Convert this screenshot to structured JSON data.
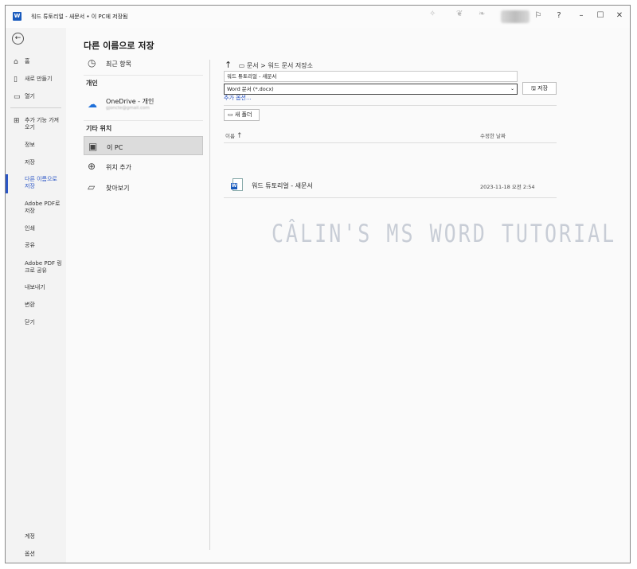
{
  "titlebar": {
    "title": "워드 튜토리얼 - 새문서 • 이 PC에 저장됨",
    "app_icon": "word-logo",
    "buttons": [
      "feedback-icon",
      "help-icon",
      "minimize-icon",
      "maximize-icon",
      "close-icon"
    ]
  },
  "sidebar": {
    "items": [
      {
        "label": "홈",
        "icon": "home-icon"
      },
      {
        "label": "새로 만들기",
        "icon": "new-doc-icon"
      },
      {
        "label": "열기",
        "icon": "folder-open-icon"
      },
      {
        "label": "추가 기능 가져오기",
        "icon": "addin-grid-icon"
      },
      {
        "label": "정보"
      },
      {
        "label": "저장"
      },
      {
        "label": "다른 이름으로 저장"
      },
      {
        "label": "Adobe PDF로 저장"
      },
      {
        "label": "인쇄"
      },
      {
        "label": "공유"
      },
      {
        "label": "Adobe PDF 링크로 공유"
      },
      {
        "label": "내보내기"
      },
      {
        "label": "변환"
      },
      {
        "label": "닫기"
      }
    ],
    "bottom": [
      {
        "label": "계정"
      },
      {
        "label": "옵션"
      }
    ]
  },
  "main": {
    "heading": "다른 이름으로 저장",
    "recent": "최근 항목",
    "personal_section": "개인",
    "onedrive": {
      "label": "OneDrive - 개인",
      "sub": "gjoncte@gmail.com"
    },
    "other_section": "기타 위치",
    "this_pc": "이 PC",
    "add_place": "위치 추가",
    "browse": "찾아보기"
  },
  "save_panel": {
    "path": "문서 > 워드 문서 저장소",
    "filename": "워드 튜토리얼 - 새문서",
    "filetype": "Word 문서 (*.docx)",
    "save_label": "저장",
    "more_options": "추가 옵션...",
    "new_folder": "새 폴더",
    "col_name": "이름",
    "col_modified": "수정한 날짜",
    "files": [
      {
        "name": "워드 튜토리얼 - 새문서",
        "modified": "2023-11-18 오전 2:54"
      }
    ]
  },
  "watermark": "CÂLIN'S MS WORD TUTORIAL"
}
